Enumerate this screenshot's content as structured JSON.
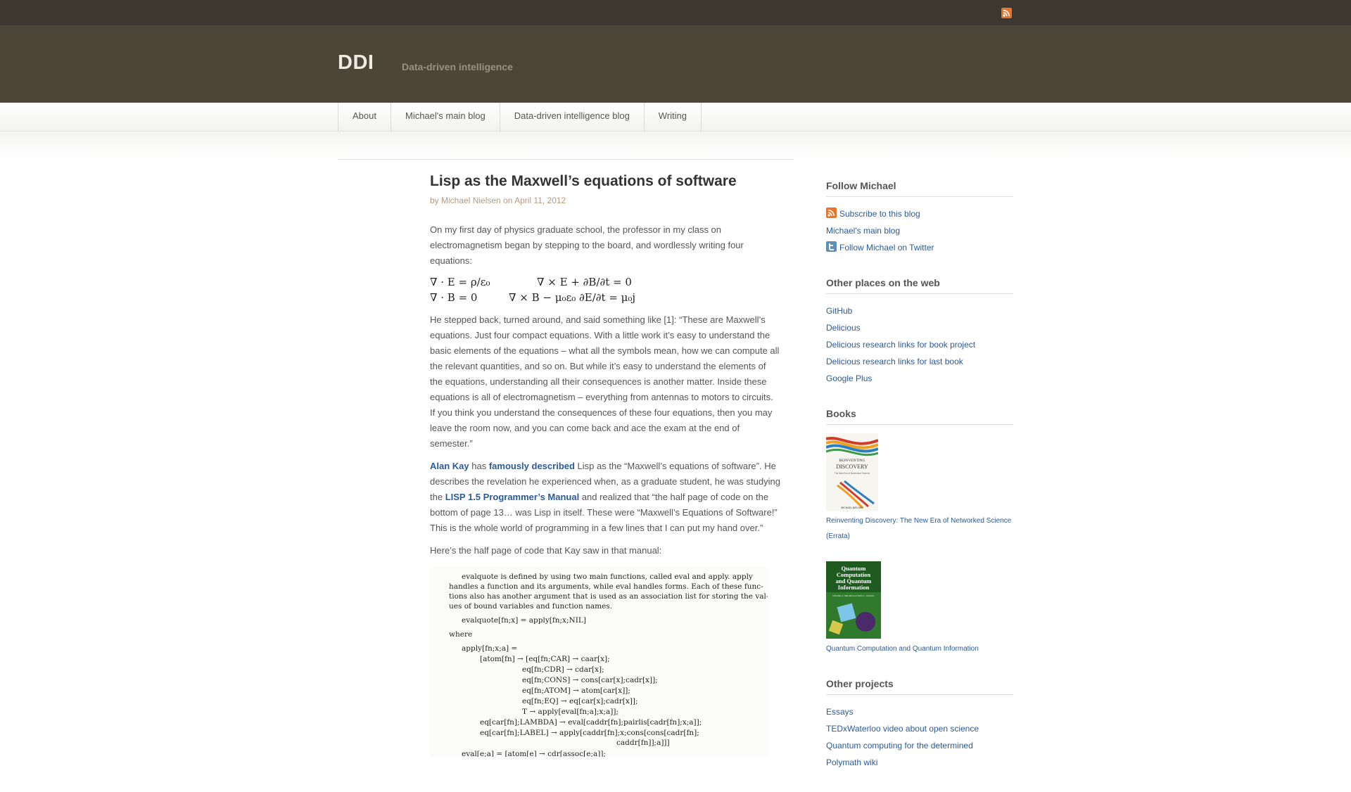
{
  "site": {
    "title": "DDI",
    "description": "Data-driven intelligence"
  },
  "nav": [
    {
      "label": "About"
    },
    {
      "label": "Michael's main blog"
    },
    {
      "label": "Data-driven intelligence blog"
    },
    {
      "label": "Writing"
    }
  ],
  "post": {
    "title": "Lisp as the Maxwell’s equations of software",
    "meta": "by Michael Nielsen on April 11, 2012",
    "p1": "On my first day of physics graduate school, the professor in my class on electromagnetism began by stepping to the board, and wordlessly writing four equations:",
    "equations": {
      "eq1": "∇ · E = ρ/ε₀",
      "eq2": "∇ × E + ∂B/∂t = 0",
      "eq3": "∇ · B = 0",
      "eq4": "∇ × B − μ₀ε₀ ∂E/∂t = μ₀j"
    },
    "p2": "He stepped back, turned around, and said something like [1]: “These are Maxwell’s equations. Just four compact equations. With a little work it’s easy to understand the basic elements of the equations – what all the symbols mean, how we can compute all the relevant quantities, and so on. But while it’s easy to understand the elements of the equations, understanding all their consequences is another matter. Inside these equations is all of electromagnetism – everything from antennas to motors to circuits. If you think you understand the consequences of these four equations, then you may leave the room now, and you can come back and ace the exam at the end of semester.”",
    "p3": {
      "link1": "Alan Kay",
      "t1": " has ",
      "link2": "famously described",
      "t2": " Lisp as the “Maxwell’s equations of software”. He describes the revelation he experienced when, as a graduate student, he was studying the ",
      "link3": "LISP 1.5 Programmer’s Manual",
      "t3": " and realized that “the half page of code on the bottom of page 13… was Lisp in itself. These were “Maxwell’s Equations of Software!” This is the whole world of programming in a few lines that I can put my hand over.”"
    },
    "p4": "Here’s the half page of code that Kay saw in that manual:",
    "scan_lines": [
      "evalquote is defined by using two main functions, called eval and apply. apply",
      "handles a function and its arguments, while eval handles forms. Each of these func-",
      "tions also has another argument that is used as an association list for storing the val-",
      "ues of bound variables and function names.",
      "evalquote[fn;x] = apply[fn;x;NIL]",
      "where",
      "apply[fn;x;a] =",
      "[atom[fn] → [eq[fn;CAR] → caar[x];",
      "eq[fn;CDR] → cdar[x];",
      "eq[fn;CONS] → cons[car[x];cadr[x]];",
      "eq[fn;ATOM] → atom[car[x]];",
      "eq[fn;EQ] → eq[car[x];cadr[x]];",
      "T → apply[eval[fn;a];x;a]];",
      "eq[car[fn];LAMBDA] → eval[caddr[fn];pairlis[cadr[fn];x;a]];",
      "eq[car[fn];LABEL] → apply[caddr[fn];x;cons[cons[cadr[fn];",
      "caddr[fn]];a]]]",
      "eval[e;a] = [atom[e] → cdr[assoc[e;a]];"
    ]
  },
  "sidebar": {
    "follow": {
      "title": "Follow Michael",
      "items": [
        "Subscribe to this blog",
        "Michael's main blog",
        "Follow Michael on Twitter"
      ]
    },
    "places": {
      "title": "Other places on the web",
      "items": [
        "GitHub",
        "Delicious",
        "Delicious research links for book project",
        "Delicious research links for last book",
        "Google Plus"
      ]
    },
    "books": {
      "title": "Books",
      "book1": {
        "link": "Reinventing Discovery: The New Era of Networked Science",
        "errata": "(Errata)",
        "cover_title": "REINVENTING DISCOVERY",
        "cover_subtitle": "The New Era of Networked Science",
        "cover_author": "MICHAEL NIELSEN"
      },
      "book2": {
        "link": "Quantum Computation and Quantum Information",
        "cover_title": "Quantum Computation and Quantum Information",
        "cover_authors": "MICHAEL A. NIELSEN and ISAAC L. CHUANG"
      }
    },
    "projects": {
      "title": "Other projects",
      "items": [
        "Essays",
        "TEDxWaterloo video about open science",
        "Quantum computing for the determined",
        "Polymath wiki"
      ]
    }
  },
  "colors": {
    "topbar": "#3d372f",
    "header": "#4d4538",
    "link": "#2c5a96",
    "rss": "#e8742a",
    "twitter": "#5f8fb5"
  }
}
